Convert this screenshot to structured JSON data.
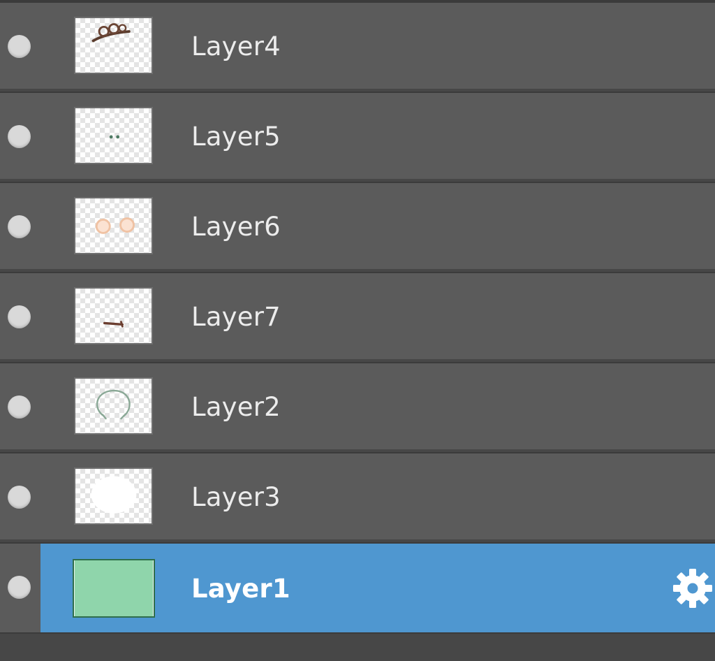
{
  "layers_panel": {
    "layers": [
      {
        "name": "Layer4",
        "visible": true,
        "selected": false,
        "thumbnail": "brown-arc-strokes"
      },
      {
        "name": "Layer5",
        "visible": true,
        "selected": false,
        "thumbnail": "two-green-dots"
      },
      {
        "name": "Layer6",
        "visible": true,
        "selected": false,
        "thumbnail": "two-peach-circles"
      },
      {
        "name": "Layer7",
        "visible": true,
        "selected": false,
        "thumbnail": "small-dark-stroke"
      },
      {
        "name": "Layer2",
        "visible": true,
        "selected": false,
        "thumbnail": "green-outline-circle"
      },
      {
        "name": "Layer3",
        "visible": true,
        "selected": false,
        "thumbnail": "white-blob"
      },
      {
        "name": "Layer1",
        "visible": true,
        "selected": true,
        "thumbnail": "solid-mint-fill"
      }
    ],
    "colors": {
      "row_background": "#5b5b5b",
      "selected_background": "#4f97d0",
      "layer1_fill": "#8fd5ab",
      "text": "#ececec"
    },
    "selected_layer_icon": "gear-icon"
  }
}
